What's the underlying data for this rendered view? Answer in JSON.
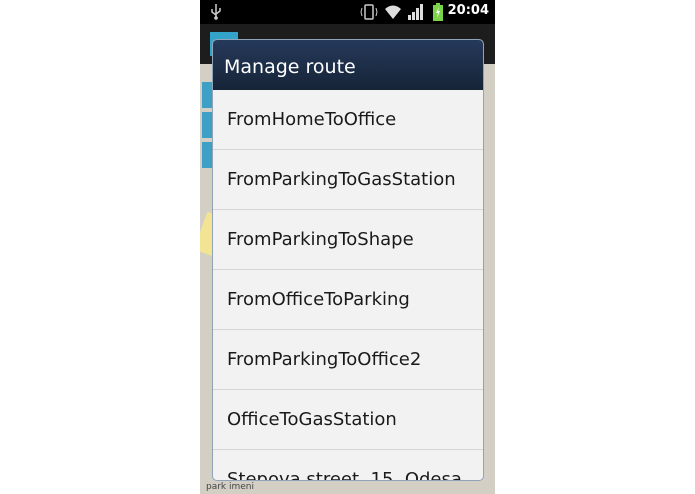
{
  "status_bar": {
    "time": "20:04",
    "icons": [
      "usb-icon",
      "vibrate-icon",
      "wifi-icon",
      "signal-icon",
      "battery-icon"
    ]
  },
  "map": {
    "label": "park imeni"
  },
  "dialog": {
    "title": "Manage route",
    "routes": [
      "FromHomeToOffice",
      "FromParkingToGasStation",
      "FromParkingToShape",
      "FromOfficeToParking",
      "FromParkingToOffice2",
      "OfficeToGasStation",
      "Stepova street, 15, Odesa,"
    ]
  },
  "colors": {
    "title_bar": "#1f3150",
    "list_bg": "#f2f2f2",
    "accent": "#33a3c9"
  }
}
